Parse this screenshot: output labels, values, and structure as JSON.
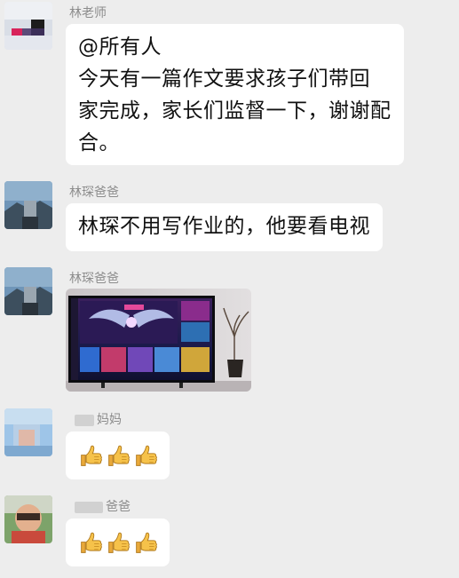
{
  "messages": [
    {
      "sender": "林老师",
      "lines": [
        "@所有人",
        "今天有一篇作文要求孩子们带回",
        "家完成，家长们监督一下，谢谢配",
        "合。"
      ]
    },
    {
      "sender": "林琛爸爸",
      "lines": [
        "林琛不用写作业的，他要看电视"
      ]
    },
    {
      "sender": "林琛爸爸",
      "image": "tv-photo"
    },
    {
      "sender": "妈妈",
      "emoji": [
        "thumbs-up-icon",
        "thumbs-up-icon",
        "thumbs-up-icon"
      ]
    },
    {
      "sender": "爸爸",
      "emoji": [
        "thumbs-up-icon",
        "thumbs-up-icon",
        "thumbs-up-icon"
      ]
    }
  ],
  "colors": {
    "background": "#ededed",
    "bubble": "#ffffff",
    "sender_name": "#8c8c8c",
    "thumb_yellow": "#f6c24a"
  }
}
